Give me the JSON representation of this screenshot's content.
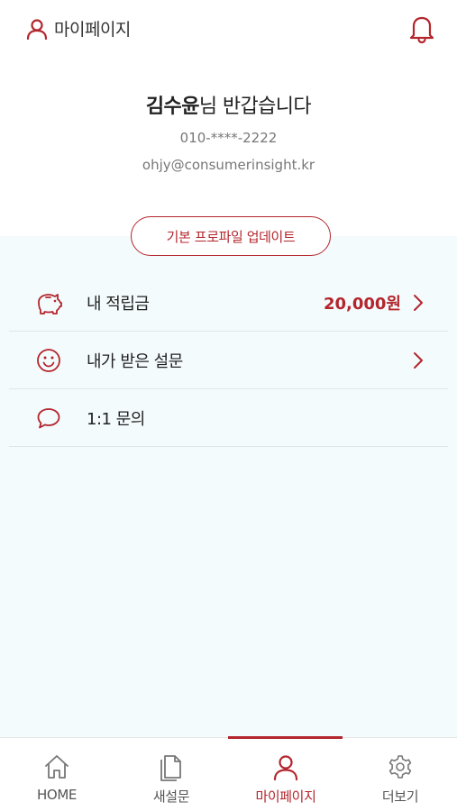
{
  "header": {
    "title": "마이페이지",
    "user_icon": "user-icon",
    "bell_icon": "bell-icon"
  },
  "profile": {
    "name": "김수윤",
    "greeting_suffix": "님 반갑습니다",
    "phone": "010-****-2222",
    "email": "ohjy@consumerinsight.kr",
    "update_button": "기본 프로파일 업데이트"
  },
  "menu": [
    {
      "icon": "piggy-bank-icon",
      "label": "내 적립금",
      "value": "20,000원",
      "has_chevron": true
    },
    {
      "icon": "smiley-icon",
      "label": "내가 받은 설문",
      "value": "",
      "has_chevron": true
    },
    {
      "icon": "speech-bubble-icon",
      "label": "1:1 문의",
      "value": "",
      "has_chevron": false
    }
  ],
  "bottom_nav": [
    {
      "icon": "home-icon",
      "label": "HOME"
    },
    {
      "icon": "document-icon",
      "label": "새설문"
    },
    {
      "icon": "user-icon",
      "label": "마이페이지",
      "active": true
    },
    {
      "icon": "gear-icon",
      "label": "더보기"
    }
  ],
  "colors": {
    "accent": "#b3262d",
    "content_bg": "#f4fbfd",
    "divider": "#dfe6e8"
  }
}
